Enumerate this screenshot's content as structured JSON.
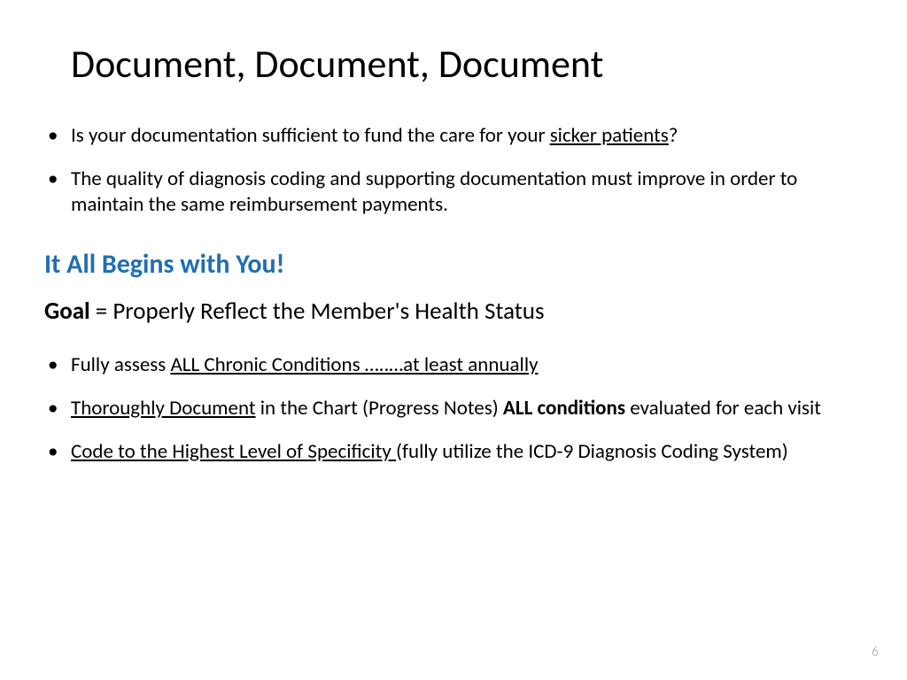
{
  "title": "Document, Document, Document",
  "topBullets": {
    "b1_pre": "Is your documentation sufficient to fund the care for your ",
    "b1_u": "sicker patients",
    "b1_post": "?",
    "b2": "The quality of diagnosis coding and supporting documentation must improve in order to maintain the same reimbursement payments."
  },
  "subheading": "It All Begins with You!",
  "goal": {
    "label": "Goal",
    "rest": " = Properly Reflect the Member's Health Status"
  },
  "bottomBullets": {
    "b1_pre": "Fully assess ",
    "b1_u": "ALL Chronic Conditions …..…at least annually",
    "b2_u": "Thoroughly Document",
    "b2_mid": " in the Chart (Progress Notes) ",
    "b2_bold": "ALL conditions",
    "b2_post": " evaluated for each visit",
    "b3_u": "Code to the Highest Level of Specificity ",
    "b3_post": "(fully utilize the ICD-9 Diagnosis Coding System)"
  },
  "pageNumber": "6"
}
